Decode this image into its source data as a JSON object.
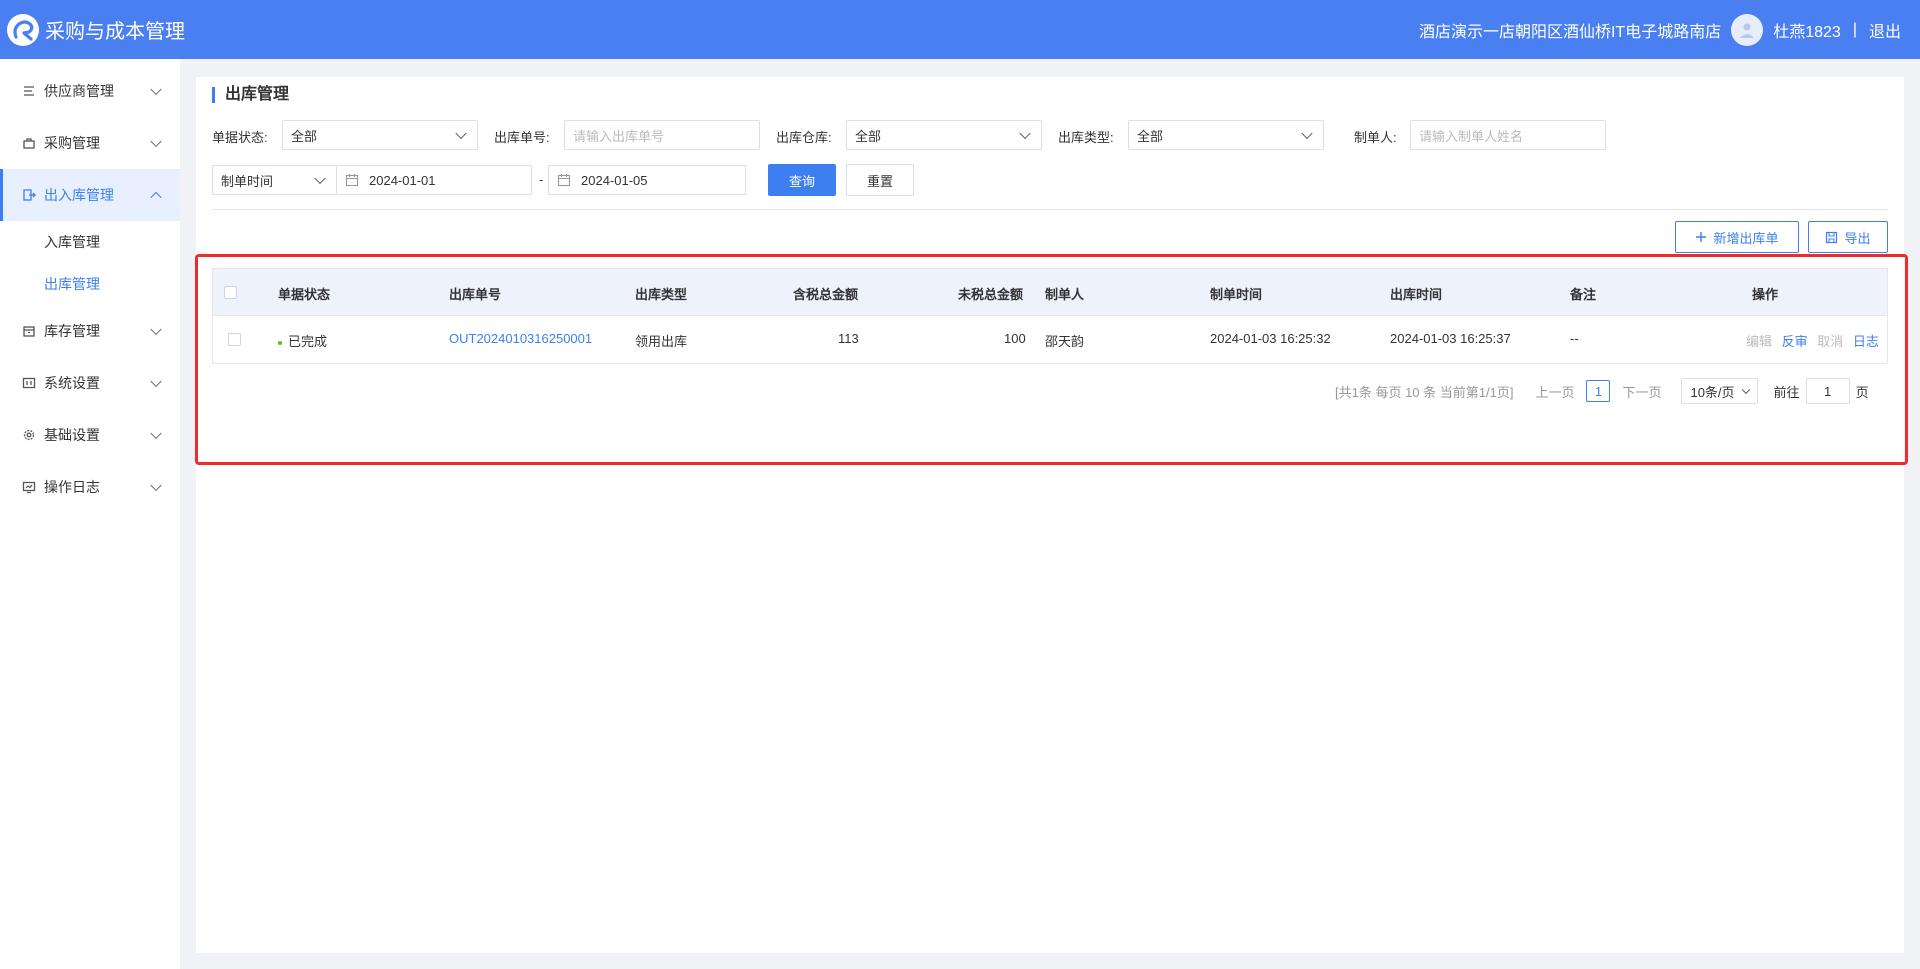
{
  "app": {
    "title": "采购与成本管理"
  },
  "header": {
    "store": "酒店演示一店朝阳区酒仙桥IT电子城路南店",
    "user": "杜燕1823",
    "separator": "|",
    "logout": "退出"
  },
  "sidebar": {
    "items": [
      {
        "label": "供应商管理",
        "icon": "supplier-icon"
      },
      {
        "label": "采购管理",
        "icon": "purchase-icon"
      },
      {
        "label": "出入库管理",
        "icon": "stock-io-icon",
        "open": true,
        "children": [
          {
            "label": "入库管理"
          },
          {
            "label": "出库管理",
            "active": true
          }
        ]
      },
      {
        "label": "库存管理",
        "icon": "inventory-icon"
      },
      {
        "label": "系统设置",
        "icon": "system-icon"
      },
      {
        "label": "基础设置",
        "icon": "gear-icon"
      },
      {
        "label": "操作日志",
        "icon": "log-icon"
      }
    ]
  },
  "page": {
    "title": "出库管理"
  },
  "filters": {
    "status_label": "单据状态:",
    "status_value": "全部",
    "order_no_label": "出库单号:",
    "order_no_placeholder": "请输入出库单号",
    "warehouse_label": "出库仓库:",
    "warehouse_value": "全部",
    "type_label": "出库类型:",
    "type_value": "全部",
    "creator_label": "制单人:",
    "creator_placeholder": "请输入制单人姓名",
    "time_type_value": "制单时间",
    "date_start": "2024-01-01",
    "date_sep": "-",
    "date_end": "2024-01-05",
    "query_button": "查询",
    "reset_button": "重置"
  },
  "actions": {
    "add_button": "新增出库单",
    "export_button": "导出"
  },
  "table": {
    "columns": [
      "单据状态",
      "出库单号",
      "出库类型",
      "含税总金额",
      "未税总金额",
      "制单人",
      "制单时间",
      "出库时间",
      "备注",
      "操作"
    ],
    "rows": [
      {
        "status": "已完成",
        "order_no": "OUT2024010316250001",
        "type": "领用出库",
        "tax_total": "113",
        "net_total": "100",
        "creator": "邵天韵",
        "created_at": "2024-01-03 16:25:32",
        "out_at": "2024-01-03 16:25:37",
        "remark": "--",
        "ops": [
          "编辑",
          "反审",
          "取消",
          "日志"
        ]
      }
    ]
  },
  "pagination": {
    "summary": "[共1条 每页 10 条 当前第1/1页]",
    "prev": "上一页",
    "page": "1",
    "next": "下一页",
    "page_size": "10条/页",
    "goto_label": "前往",
    "goto_value": "1",
    "goto_unit": "页"
  },
  "colors": {
    "brand": "#4a7ff2",
    "accent": "#3d7ff0",
    "highlight": "#ef2b2b",
    "success": "#52c41a"
  }
}
